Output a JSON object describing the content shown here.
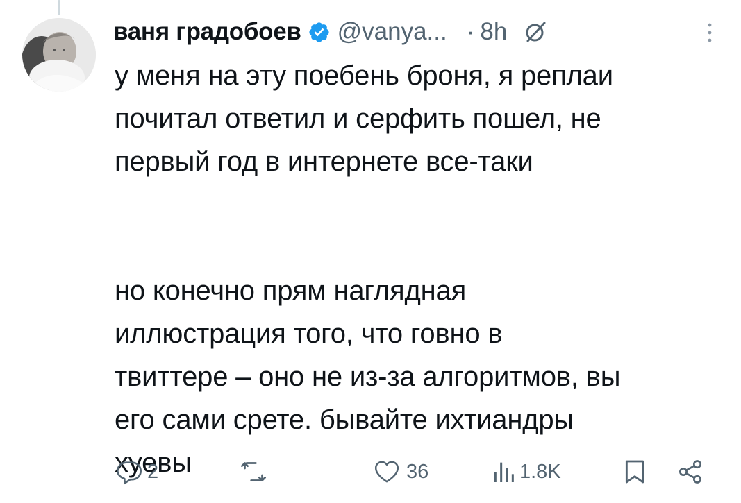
{
  "tweet": {
    "author": {
      "display_name": "ваня градобоев",
      "handle": "@vanya...",
      "verified": true,
      "avatar_icon": "profile-photo"
    },
    "separator": "·",
    "time": "8h",
    "text": "у меня на эту поебень броня, я реплаи\nпочитал ответил и серфить пошел, не\nпервый год в интернете все-таки\n\n\nно конечно прям наглядная\nиллюстрация того, что говно в\nтвиттере – оно не из-за алгоритмов, вы\nего сами срете. бывайте ихтиандры\nхуевы",
    "actions": {
      "reply": {
        "icon": "reply-icon",
        "count": "2"
      },
      "retweet": {
        "icon": "retweet-icon",
        "count": ""
      },
      "like": {
        "icon": "heart-icon",
        "count": "36"
      },
      "views": {
        "icon": "views-icon",
        "count": "1.8K"
      },
      "bookmark": {
        "icon": "bookmark-icon"
      },
      "share": {
        "icon": "share-icon"
      }
    }
  },
  "colors": {
    "text_primary": "#0f1419",
    "text_secondary": "#536471",
    "verified_blue": "#1d9bf0",
    "thread_line": "#cfd9de"
  }
}
